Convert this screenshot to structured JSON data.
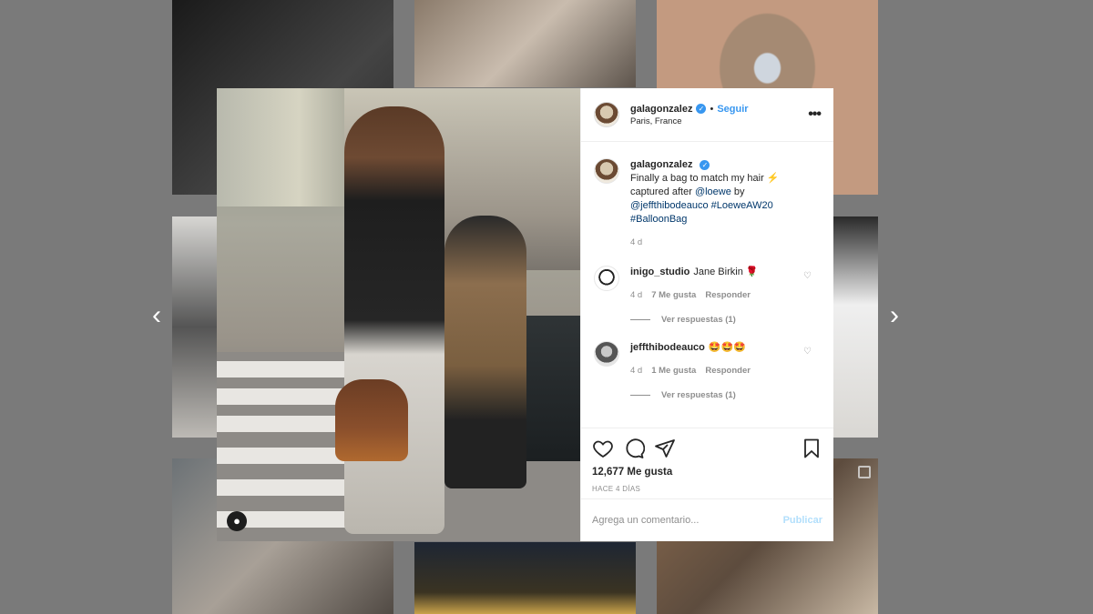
{
  "post": {
    "username": "galagonzalez",
    "follow_label": "Seguir",
    "location": "Paris, France",
    "more_label": "•••",
    "caption_user": "galagonzalez",
    "caption_line1": "Finally a bag to match my hair ⚡",
    "caption_line2": "captured after ",
    "caption_mention1": "@loewe",
    "caption_by": " by",
    "caption_mention2": "@jeffthibodeauco",
    "caption_tag1": " #LoeweAW20",
    "caption_tag2": "#BalloonBag",
    "caption_time": "4 d",
    "likes": "12,677 Me gusta",
    "posted_time": "HACE 4 DÍAS",
    "comment_placeholder": "Agrega un comentario...",
    "publish_label": "Publicar"
  },
  "comments": [
    {
      "user": "inigo_studio",
      "text": "Jane Birkin 🌹",
      "time": "4 d",
      "likes": "7 Me gusta",
      "reply_label": "Responder",
      "view_replies": "Ver respuestas (1)"
    },
    {
      "user": "jeffthibodeauco",
      "text": "🤩🤩🤩",
      "time": "4 d",
      "likes": "1 Me gusta",
      "reply_label": "Responder",
      "view_replies": "Ver respuestas (1)"
    }
  ],
  "nav": {
    "prev": "‹",
    "next": "›"
  },
  "colors": {
    "accent": "#3897f0",
    "text": "#262626",
    "muted": "#8e8e8e"
  }
}
